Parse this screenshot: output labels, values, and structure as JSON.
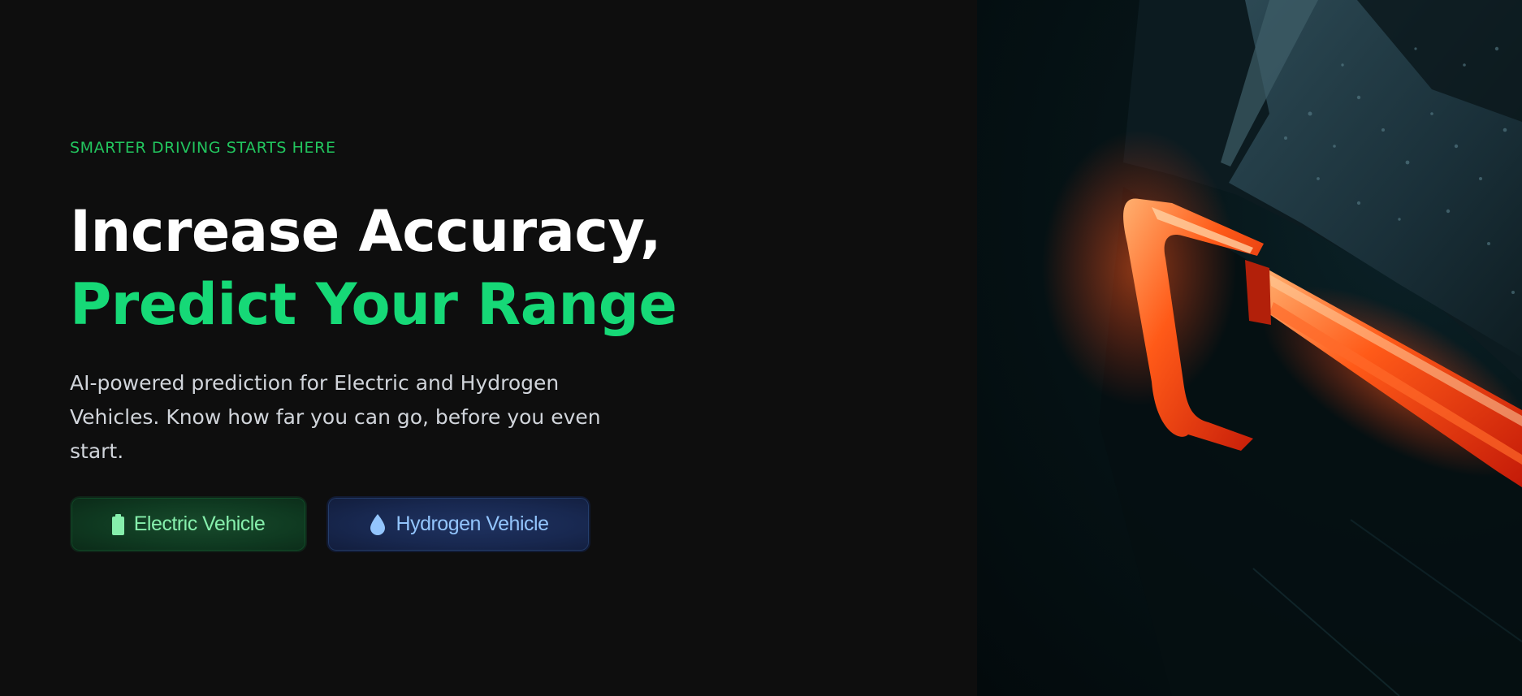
{
  "hero": {
    "eyebrow": "SMARTER DRIVING STARTS HERE",
    "headline_line1": "Increase Accuracy,",
    "headline_line2": "Predict Your Range",
    "description": "AI-powered prediction for Electric and Hydrogen Vehicles. Know how far you can go, before you even start.",
    "buttons": {
      "electric": {
        "label": "Electric Vehicle",
        "icon": "battery-icon"
      },
      "hydrogen": {
        "label": "Hydrogen Vehicle",
        "icon": "droplet-icon"
      }
    }
  },
  "photo": {
    "subject": "car-taillight-photo"
  },
  "colors": {
    "background": "#0e0e0e",
    "accent_green": "#16d977",
    "eyebrow_green": "#22c55e",
    "electric_text": "#86efac",
    "hydrogen_text": "#93c5fd",
    "taillight_red": "#ff3b12"
  }
}
